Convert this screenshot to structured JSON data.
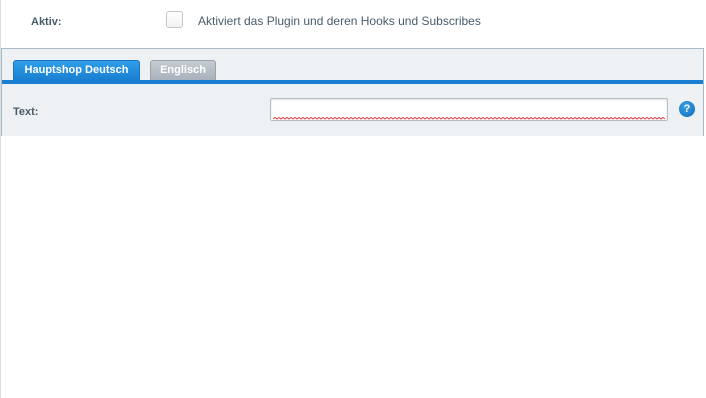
{
  "active_setting": {
    "label": "Aktiv:",
    "checked": false,
    "description": "Aktiviert das Plugin und deren Hooks und Subscribes"
  },
  "translation_tabs": [
    {
      "label": "Hauptshop Deutsch",
      "active": true
    },
    {
      "label": "Englisch",
      "active": false
    }
  ],
  "text_field": {
    "label": "Text:",
    "value": "",
    "placeholder": ""
  },
  "help": {
    "icon": "help-icon",
    "glyph": "?"
  },
  "colors": {
    "accent": "#1a7fd2",
    "inactive_tab": "#a8b2bc",
    "panel_background": "#eef1f4",
    "label_text": "#475c6a"
  }
}
